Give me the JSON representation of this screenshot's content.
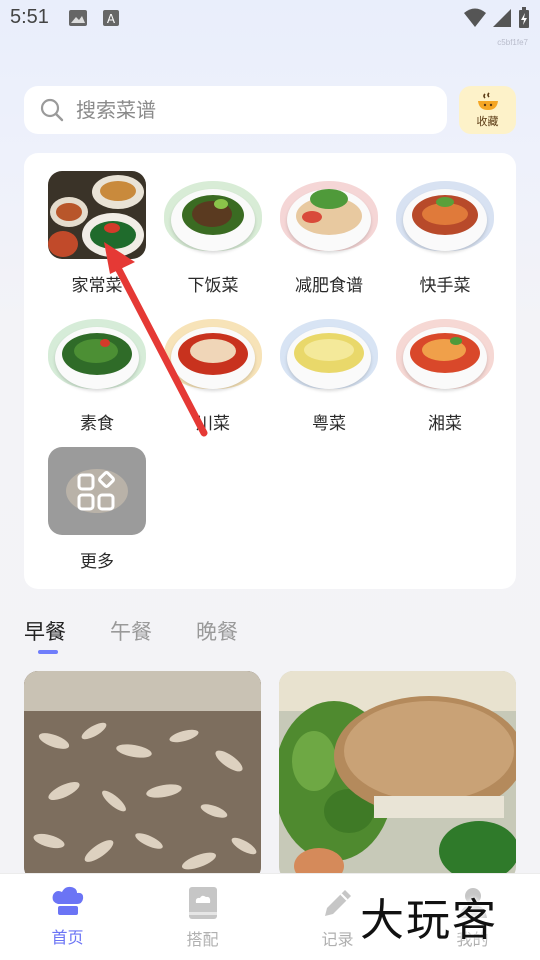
{
  "status_bar": {
    "time": "5:51",
    "icons": [
      "image-icon",
      "a-icon",
      "wifi-icon",
      "signal-icon",
      "battery-charging-icon"
    ]
  },
  "build_tag": "c5bf1fe7",
  "search": {
    "placeholder": "搜索菜谱"
  },
  "favorites": {
    "label": "收藏"
  },
  "categories": [
    {
      "label": "家常菜",
      "icon": "home-dishes-photo",
      "active": true
    },
    {
      "label": "下饭菜",
      "icon": "rice-dishes-photo"
    },
    {
      "label": "减肥食谱",
      "icon": "diet-recipes-photo"
    },
    {
      "label": "快手菜",
      "icon": "quick-dishes-photo"
    },
    {
      "label": "素食",
      "icon": "vegetarian-photo"
    },
    {
      "label": "川菜",
      "icon": "sichuan-photo"
    },
    {
      "label": "粤菜",
      "icon": "cantonese-photo"
    },
    {
      "label": "湘菜",
      "icon": "hunan-photo"
    },
    {
      "label": "更多",
      "icon": "more-grid-icon"
    }
  ],
  "meal_tabs": [
    {
      "label": "早餐",
      "active": true
    },
    {
      "label": "午餐",
      "active": false
    },
    {
      "label": "晚餐",
      "active": false
    }
  ],
  "recipe_cards": [
    {
      "image": "dried-shrimp-photo"
    },
    {
      "image": "sandwich-broccoli-photo"
    }
  ],
  "bottom_nav": [
    {
      "label": "首页",
      "icon": "chef-hat-icon",
      "active": true
    },
    {
      "label": "搭配",
      "icon": "recipe-book-icon",
      "active": false
    },
    {
      "label": "记录",
      "icon": "pencil-icon",
      "active": false
    },
    {
      "label": "我的",
      "icon": "profile-icon",
      "active": false
    }
  ],
  "watermark": "大玩客",
  "colors": {
    "accent": "#6b74f5",
    "favorites_bg": "#fdf2c9",
    "arrow": "#e53935"
  }
}
